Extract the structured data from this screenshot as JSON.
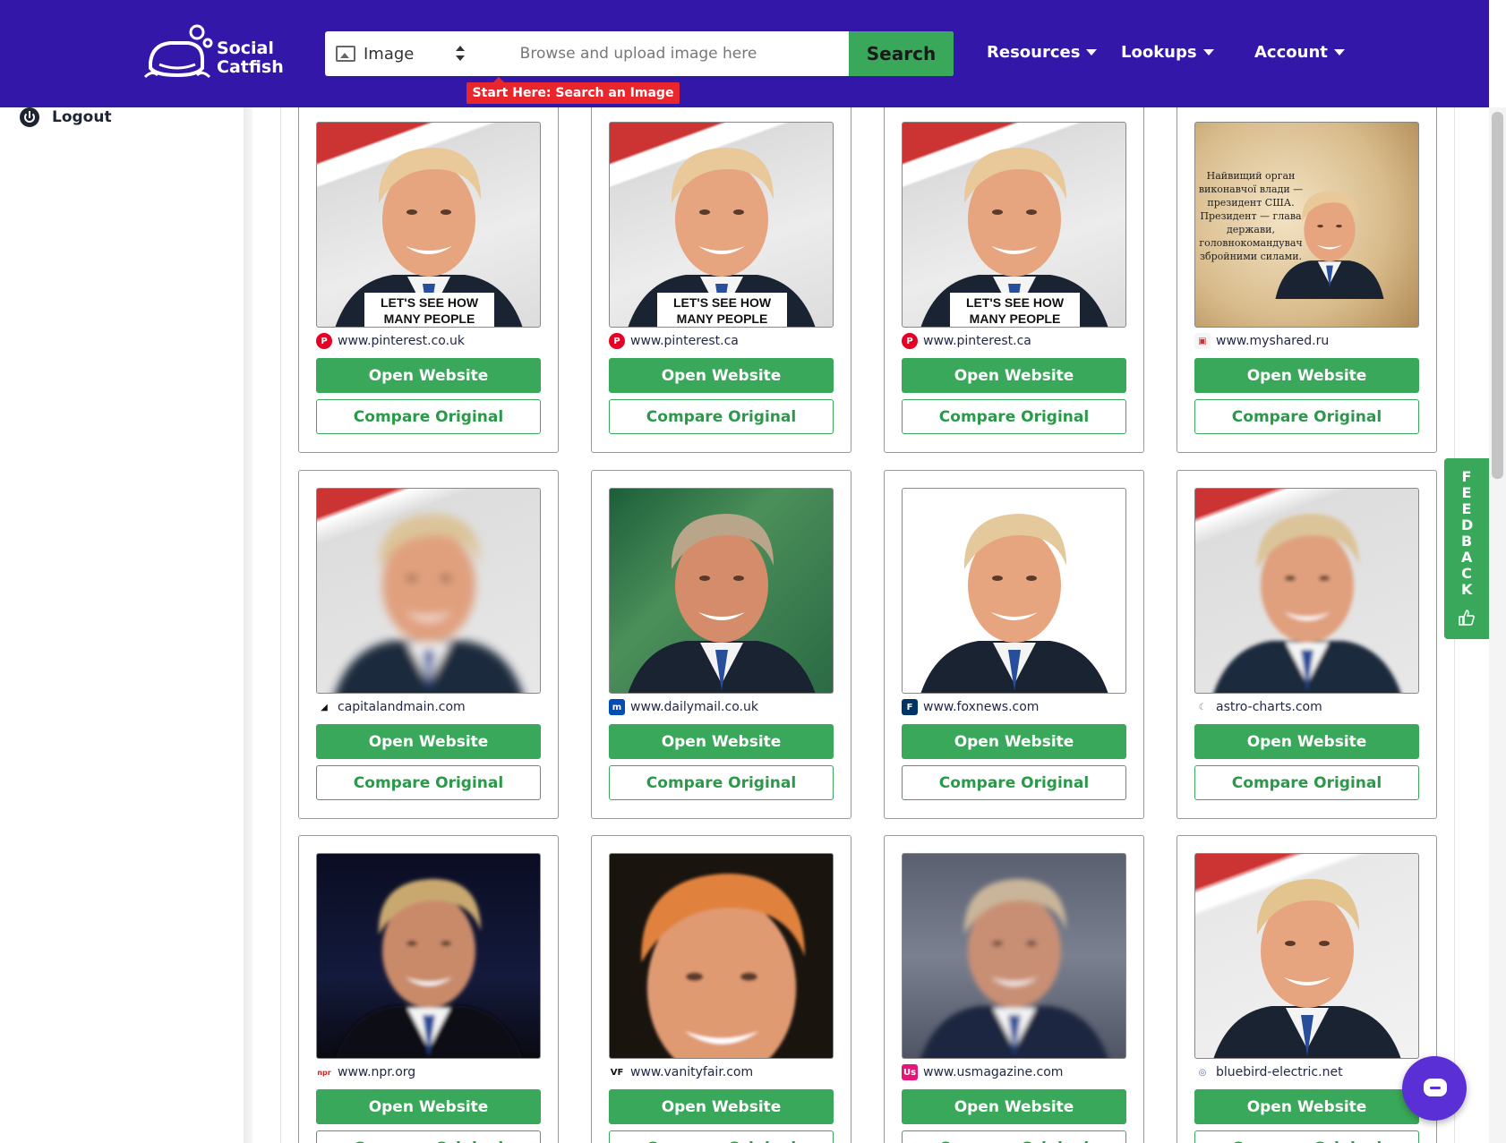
{
  "brand": {
    "name_line1": "Social",
    "name_line2": "Catfish"
  },
  "search": {
    "type_label": "Image",
    "placeholder": "Browse and upload image here",
    "button_label": "Search",
    "hint": "Start Here: Search an Image"
  },
  "nav": {
    "resources": "Resources",
    "lookups": "Lookups",
    "account": "Account"
  },
  "sidebar": {
    "logout_label": "Logout"
  },
  "feedback": {
    "label": "FEEDBACK"
  },
  "buttons": {
    "open": "Open Website",
    "compare": "Compare Original"
  },
  "results": [
    {
      "domain": "www.pinterest.co.uk",
      "favicon": "pinterest-icon",
      "image_caption": "LET'S SEE HOW MANY PEOPLE LOVE TRUMP"
    },
    {
      "domain": "www.pinterest.ca",
      "favicon": "pinterest-icon",
      "image_caption": "LET'S SEE HOW MANY PEOPLE LOVE TRUMP"
    },
    {
      "domain": "www.pinterest.ca",
      "favicon": "pinterest-icon",
      "image_caption": "LET'S SEE HOW MANY PEOPLE LOVE TRUMP"
    },
    {
      "domain": "www.myshared.ru",
      "favicon": "myshared-icon",
      "image_caption": "Найвищий орган виконавчої влади — президент США. Президент — глава держави, головнокомандувач збройними силами."
    },
    {
      "domain": "capitalandmain.com",
      "favicon": "capitalandmain-icon",
      "image_caption": ""
    },
    {
      "domain": "www.dailymail.co.uk",
      "favicon": "dailymail-icon",
      "image_caption": ""
    },
    {
      "domain": "www.foxnews.com",
      "favicon": "foxnews-icon",
      "image_caption": ""
    },
    {
      "domain": "astro-charts.com",
      "favicon": "moon-icon",
      "image_caption": ""
    },
    {
      "domain": "www.npr.org",
      "favicon": "npr-icon",
      "image_caption": ""
    },
    {
      "domain": "www.vanityfair.com",
      "favicon": "vanityfair-icon",
      "image_caption": ""
    },
    {
      "domain": "www.usmagazine.com",
      "favicon": "usmagazine-icon",
      "image_caption": ""
    },
    {
      "domain": "bluebird-electric.net",
      "favicon": "globe-icon",
      "image_caption": ""
    }
  ],
  "colors": {
    "header": "#3217a8",
    "accent_green": "#3aa85a",
    "hint_red": "#e8262c",
    "chat": "#5a2fd6"
  }
}
